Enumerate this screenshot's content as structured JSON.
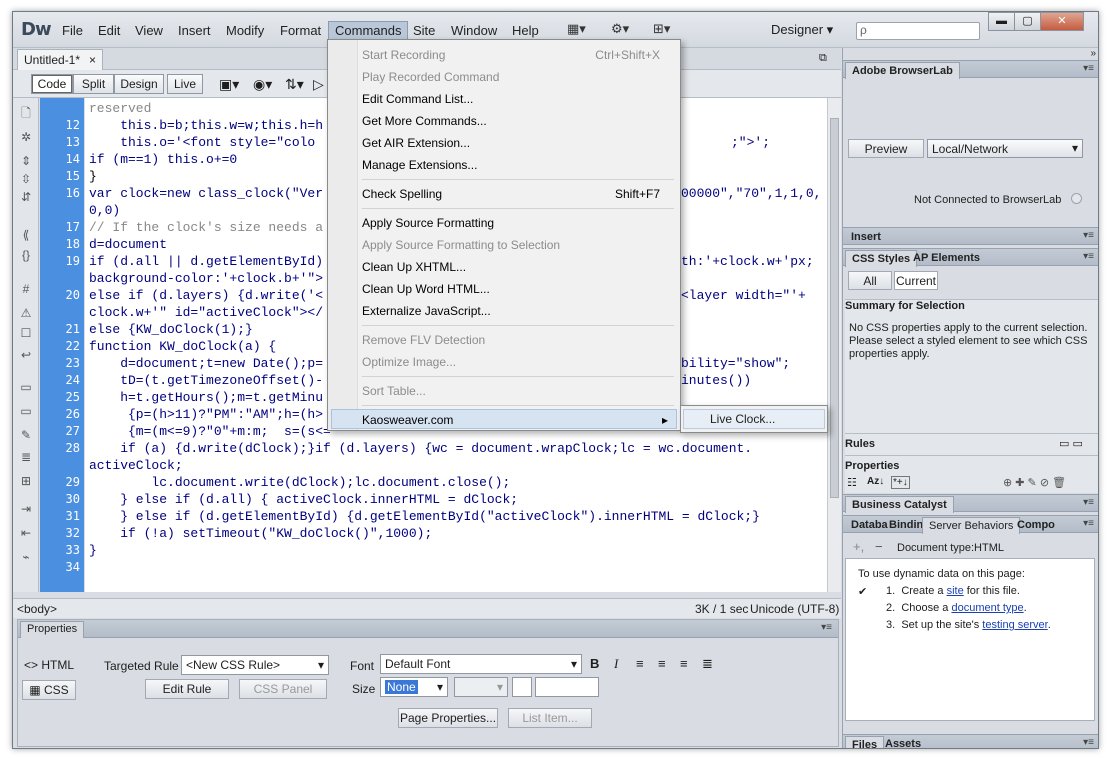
{
  "app": {
    "logo": "Dw",
    "workspace": "Designer",
    "search_placeholder": "ρ"
  },
  "menubar": {
    "items": [
      "File",
      "Edit",
      "View",
      "Insert",
      "Modify",
      "Format",
      "Commands",
      "Site",
      "Window",
      "Help"
    ]
  },
  "document": {
    "tab": "Untitled-1*",
    "close": "×"
  },
  "viewbar": {
    "code": "Code",
    "split": "Split",
    "design": "Design",
    "live": "Live"
  },
  "code": {
    "line_numbers": [
      "12",
      "13",
      "14",
      "15",
      "16",
      "17",
      "18",
      "19",
      "20",
      "21",
      "22",
      "23",
      "24",
      "25",
      "26",
      "27",
      "28",
      "29",
      "30",
      "31",
      "32",
      "33",
      "34"
    ],
    "lines": [
      "reserved",
      "    this.b=b;this.w=w;this.h=h",
      "    this.o='<font style=\"colo",
      "if (m==1) this.o+=0",
      "}",
      "var clock=new class_clock(\"Ver",
      "0,0)",
      "// If the clock's size needs a",
      "d=document",
      "if (d.all || d.getElementById)",
      "background-color:'+clock.b+'\">",
      "else if (d.layers) {d.write('<",
      "clock.w+'\" id=\"activeClock\"></",
      "else {KW_doClock(1);}",
      "function KW_doClock(a) {",
      "    d=document;t=new Date();p=",
      "    tD=(t.getTimezoneOffset()-",
      "    h=t.getHours();m=t.getMinu",
      "     {p=(h>11)?\"PM\":\"AM\";h=(h>",
      "     {m=(m<=9)?\"0\"+m:m;  s=(s<=",
      "    if (a) {d.write(dClock);}if (d.layers) {wc = document.wrapClock;lc = wc.document.",
      "activeClock;",
      "        lc.document.write(dClock);lc.document.close();",
      "    } else if (d.all) { activeClock.innerHTML = dClock;",
      "    } else if (d.getElementById) {d.getElementById(\"activeClock\").innerHTML = dClock;}",
      "    if (!a) setTimeout(\"KW_doClock()\",1000);",
      "}"
    ],
    "right_fragments": {
      "l13": ";\">';",
      "l16": "00000\",\"70\",1,1,0,",
      "l19": "th:'+clock.w+'px;",
      "l20": "<layer width=\"'+",
      "l23": "bility=\"show\";",
      "l24": "inutes())"
    }
  },
  "statusbar": {
    "tag": "<body>",
    "size": "3K / 1 sec",
    "encoding": "Unicode (UTF-8)"
  },
  "properties": {
    "title": "Properties",
    "html_btn": "HTML",
    "css_btn": "CSS",
    "targeted_rule_label": "Targeted Rule",
    "targeted_rule_value": "<New CSS Rule>",
    "edit_rule": "Edit Rule",
    "css_panel": "CSS Panel",
    "font_label": "Font",
    "font_value": "Default Font",
    "size_label": "Size",
    "size_value": "None",
    "page_properties": "Page Properties...",
    "list_item": "List Item..."
  },
  "commands_menu": {
    "items": [
      {
        "label": "Start Recording",
        "shortcut": "Ctrl+Shift+X",
        "enabled": false
      },
      {
        "label": "Play Recorded Command",
        "shortcut": "",
        "enabled": false
      },
      {
        "label": "Edit Command List...",
        "shortcut": "",
        "enabled": true
      },
      {
        "label": "Get More Commands...",
        "shortcut": "",
        "enabled": true
      },
      {
        "label": "Get AIR Extension...",
        "shortcut": "",
        "enabled": true
      },
      {
        "label": "Manage Extensions...",
        "shortcut": "",
        "enabled": true
      },
      {
        "label": "Check Spelling",
        "shortcut": "Shift+F7",
        "enabled": true
      },
      {
        "label": "Apply Source Formatting",
        "shortcut": "",
        "enabled": true
      },
      {
        "label": "Apply Source Formatting to Selection",
        "shortcut": "",
        "enabled": false
      },
      {
        "label": "Clean Up XHTML...",
        "shortcut": "",
        "enabled": true
      },
      {
        "label": "Clean Up Word HTML...",
        "shortcut": "",
        "enabled": true
      },
      {
        "label": "Externalize JavaScript...",
        "shortcut": "",
        "enabled": true
      },
      {
        "label": "Remove FLV Detection",
        "shortcut": "",
        "enabled": false
      },
      {
        "label": "Optimize Image...",
        "shortcut": "",
        "enabled": false
      },
      {
        "label": "Sort Table...",
        "shortcut": "",
        "enabled": false
      },
      {
        "label": "Kaosweaver.com",
        "shortcut": "",
        "enabled": true
      }
    ],
    "submenu_item": "Live Clock..."
  },
  "right_panel": {
    "browserlab": {
      "title": "Adobe BrowserLab",
      "preview": "Preview",
      "mode": "Local/Network",
      "status": "Not Connected to BrowserLab"
    },
    "insert": "Insert",
    "css_styles": {
      "tab1": "CSS Styles",
      "tab2": "AP Elements",
      "all": "All",
      "current": "Current",
      "summary_title": "Summary for Selection",
      "summary_text": "No CSS properties apply to the current selection.  Please select a styled element to see which CSS properties apply.",
      "rules": "Rules",
      "properties": "Properties"
    },
    "business_catalyst": "Business Catalyst",
    "server": {
      "tabs": [
        "Databa",
        "Bindin",
        "Server Behaviors",
        "Compo"
      ],
      "doc_type": "Document type:HTML",
      "intro": "To use dynamic data on this page:",
      "steps": [
        {
          "num": "1.",
          "pre": "Create a ",
          "link": "site",
          "post": " for this file."
        },
        {
          "num": "2.",
          "pre": "Choose a ",
          "link": "document type",
          "post": "."
        },
        {
          "num": "3.",
          "pre": "Set up the site's ",
          "link": "testing server",
          "post": "."
        }
      ]
    },
    "files_tabs": [
      "Files",
      "Assets"
    ]
  }
}
